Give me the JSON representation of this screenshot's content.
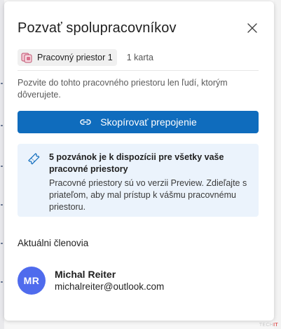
{
  "dialog": {
    "title": "Pozvať spolupracovníkov",
    "close_label": "×"
  },
  "workspace": {
    "name": "Pracovný priestor 1",
    "tab_count": "1 karta",
    "icon": "workspace-icon"
  },
  "description": "Pozvite do tohto pracovného priestoru len ľudí, ktorým dôverujete.",
  "copy_button": {
    "label": "Skopírovať prepojenie",
    "icon": "link-icon"
  },
  "info": {
    "icon": "ticket-icon",
    "title": "5 pozvánok je k dispozícii pre všetky vaše pracovné priestory",
    "body": "Pracovné priestory sú vo verzii Preview. Zdieľajte s priateľom, aby mal prístup k vášmu pracovnému priestoru."
  },
  "members": {
    "heading": "Aktuálni členovia",
    "list": [
      {
        "initials": "MR",
        "name": "Michal Reiter",
        "email": "michalreiter@outlook.com"
      }
    ]
  },
  "watermark": {
    "prefix": "TECH",
    "suffix": "IT"
  },
  "colors": {
    "accent": "#0f6cbd",
    "info_bg": "#ebf3fc",
    "avatar": "#4f6bed"
  }
}
